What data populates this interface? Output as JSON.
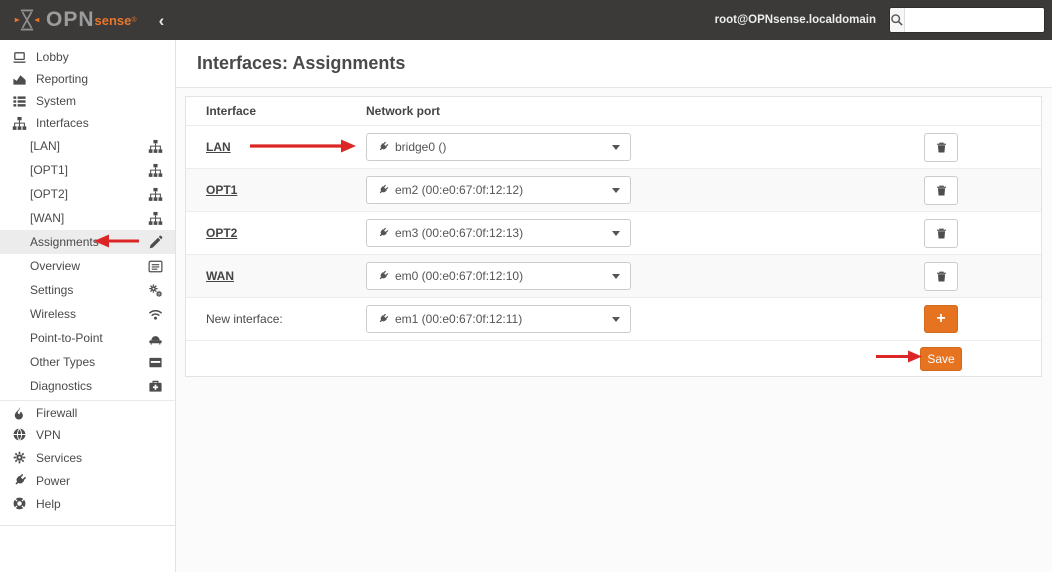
{
  "header": {
    "logo_text_primary": "OPN",
    "logo_text_secondary": "sense",
    "logo_reg": "®",
    "collapse_label": "‹",
    "username": "root@OPNsense.localdomain",
    "search_placeholder": ""
  },
  "sidebar": {
    "items": [
      {
        "label": "Lobby"
      },
      {
        "label": "Reporting"
      },
      {
        "label": "System"
      },
      {
        "label": "Interfaces"
      },
      {
        "label": "[LAN]"
      },
      {
        "label": "[OPT1]"
      },
      {
        "label": "[OPT2]"
      },
      {
        "label": "[WAN]"
      },
      {
        "label": "Assignments"
      },
      {
        "label": "Overview"
      },
      {
        "label": "Settings"
      },
      {
        "label": "Wireless"
      },
      {
        "label": "Point-to-Point"
      },
      {
        "label": "Other Types"
      },
      {
        "label": "Diagnostics"
      },
      {
        "label": "Firewall"
      },
      {
        "label": "VPN"
      },
      {
        "label": "Services"
      },
      {
        "label": "Power"
      },
      {
        "label": "Help"
      }
    ]
  },
  "main": {
    "title": "Interfaces: Assignments",
    "table": {
      "col_interface": "Interface",
      "col_network_port": "Network port",
      "rows": [
        {
          "name": "LAN",
          "port": "bridge0 ()"
        },
        {
          "name": "OPT1",
          "port": "em2 (00:e0:67:0f:12:12)"
        },
        {
          "name": "OPT2",
          "port": "em3 (00:e0:67:0f:12:13)"
        },
        {
          "name": "WAN",
          "port": "em0 (00:e0:67:0f:12:10)"
        },
        {
          "name": "New interface:",
          "port": "em1 (00:e0:67:0f:12:11)"
        }
      ],
      "add_button": "+",
      "save_button": "Save"
    }
  },
  "colors": {
    "accent_orange": "#e5731f",
    "annotation_red": "#dc2626",
    "header_bg": "#3b3a39",
    "sidebar_active_bg": "#ececec",
    "row_stripe": "#f9f9f9"
  }
}
